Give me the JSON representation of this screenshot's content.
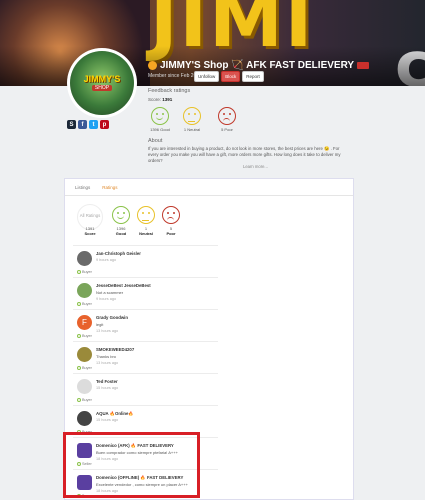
{
  "shop": {
    "title": "JIMMY'S Shop 🏹 AFK FAST DELIEVERY",
    "member_since": "Member since Feb 2019",
    "buttons": [
      "Unfollow",
      "Block",
      "Report"
    ],
    "avatar_text": "JIMMY'S",
    "avatar_sub": "SHOP",
    "banner_text": "JIMI"
  },
  "social_icons": [
    "steam-icon",
    "facebook-icon",
    "twitter-icon",
    "pinterest-icon"
  ],
  "feedback": {
    "title": "Feedback ratings",
    "score_label": "Score:",
    "score_value": "1391",
    "faces": [
      {
        "label": "1396 Good",
        "kind": "good",
        "color": "#8bc34a"
      },
      {
        "label": "1 Neutral",
        "kind": "neutral",
        "color": "#e8c22a"
      },
      {
        "label": "5 Poor",
        "kind": "poor",
        "color": "#c0392b"
      }
    ]
  },
  "about": {
    "title": "About",
    "text": "If you are interested in buying a product, do not look in more stores, the best prices are here 😉 . For every order you make you will have a gift, more orders more gifts. How long does it take to deliver my orders?",
    "learn_more": "Learn more..."
  },
  "tabs": [
    "Listings",
    "Ratings"
  ],
  "active_tab": 1,
  "summary": {
    "all": "All Ratings",
    "score_value": "1391",
    "score_label": "Score",
    "good_value": "1396",
    "good_label": "Good",
    "neutral_value": "1",
    "neutral_label": "Neutral",
    "poor_value": "5",
    "poor_label": "Poor"
  },
  "reviews": [
    {
      "name": "Jan-Christoph Geisler",
      "message": "",
      "time": "9 hours ago",
      "role": "Buyer",
      "avatar": "#6a6a6a"
    },
    {
      "name": "JesseDeBest JesseDeBest",
      "message": "Not a scammer",
      "time": "9 hours ago",
      "role": "Buyer",
      "avatar": "#7aa55a"
    },
    {
      "name": "Grady Goodwin",
      "message": "legit",
      "time": "13 hours ago",
      "role": "Buyer",
      "avatar": "#e8622c",
      "initial": "F"
    },
    {
      "name": "SMOKEWEED4207",
      "message": "Thanks bro",
      "time": "13 hours ago",
      "role": "Buyer",
      "avatar": "#9a8a3a"
    },
    {
      "name": "Ted Foster",
      "message": "",
      "time": "15 hours ago",
      "role": "Buyer",
      "avatar": "#dcdcdc"
    },
    {
      "name": "AQUA 🔥Online🔥",
      "message": "",
      "time": "15 hours ago",
      "role": "Buyer",
      "avatar": "#444444"
    },
    {
      "name": "Domenico (AFK) 🔥 FAST DELIEVERY",
      "message": "Buen comprador como siempre ptefaria! A+++",
      "time": "18 hours ago",
      "role": "Seller",
      "avatar": "#5a3fa0"
    },
    {
      "name": "Domenico (OFFLINE) 🔥 FAST DELIEVERY",
      "message": "Excelente vendedor , como siempre un placer A+++",
      "time": "18 hours ago",
      "role": "Buyer",
      "avatar": "#5a3fa0"
    }
  ]
}
